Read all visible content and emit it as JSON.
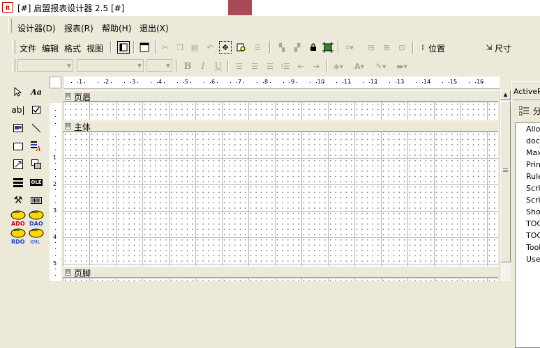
{
  "window": {
    "title": "[#] 启盟报表设计器 2.5 [#]",
    "app_icon": "report-designer-icon"
  },
  "menubar": {
    "items": [
      "设计器(D)",
      "报表(R)",
      "帮助(H)",
      "退出(X)"
    ]
  },
  "toolbar1": {
    "text_buttons": [
      "文件",
      "编辑",
      "格式",
      "视图"
    ],
    "position_label": "位置",
    "size_label": "尺寸",
    "icons": [
      "page-view-icon",
      "window-icon",
      "cut-icon",
      "copy-icon",
      "paste-icon",
      "undo-icon",
      "select-area-icon",
      "find-icon",
      "replace-icon",
      "send-back-icon",
      "bring-front-icon",
      "lock-icon",
      "fit-icon",
      "grid-snap-icon",
      "align-icon",
      "distribute-icon",
      "spacing-icon",
      "size-icon"
    ]
  },
  "toolbar2": {
    "bold": "B",
    "italic": "I",
    "underline": "U",
    "icons": [
      "align-left-icon",
      "align-center-icon",
      "align-right-icon",
      "bullets-icon",
      "outdent-icon",
      "indent-icon",
      "fill-color-icon",
      "font-color-icon",
      "line-color-icon",
      "border-style-icon"
    ]
  },
  "ruler": {
    "h_numbers": [
      "1",
      "2",
      "3",
      "4",
      "5",
      "6",
      "7",
      "8",
      "9",
      "10",
      "11",
      "12",
      "13",
      "14",
      "15",
      "16"
    ],
    "v_numbers": [
      "1",
      "2",
      "3",
      "4",
      "5"
    ]
  },
  "toolbox": {
    "tools": [
      "pointer-icon",
      "label-icon",
      "textbox-icon",
      "checkbox-icon",
      "picture-icon",
      "line-icon",
      "rectangle-icon",
      "richtext-icon",
      "subreport-icon",
      "pagebreak-icon",
      "barcode-icon",
      "ole-icon",
      "chart-icon",
      "barcode2-icon",
      "ado-icon",
      "dao-icon",
      "rdo-icon",
      "xml-icon"
    ],
    "ole_label": "OLE",
    "ado_label": "ADO",
    "dao_label": "DAO",
    "rdo_label": "RDO",
    "xml_label": "XML"
  },
  "design": {
    "sections": [
      {
        "name": "页眉"
      },
      {
        "name": "主体"
      },
      {
        "name": "页脚"
      }
    ],
    "collapse_glyph": "⊟"
  },
  "properties": {
    "header": "ActiveR",
    "sort_label": "分",
    "items": [
      "AllowS",
      "docum",
      "MaxPa",
      "PrintW",
      "RulerU",
      "Script",
      "Script",
      "ShowP",
      "TOC",
      "TOC",
      "ToolTi",
      "UserD"
    ]
  }
}
